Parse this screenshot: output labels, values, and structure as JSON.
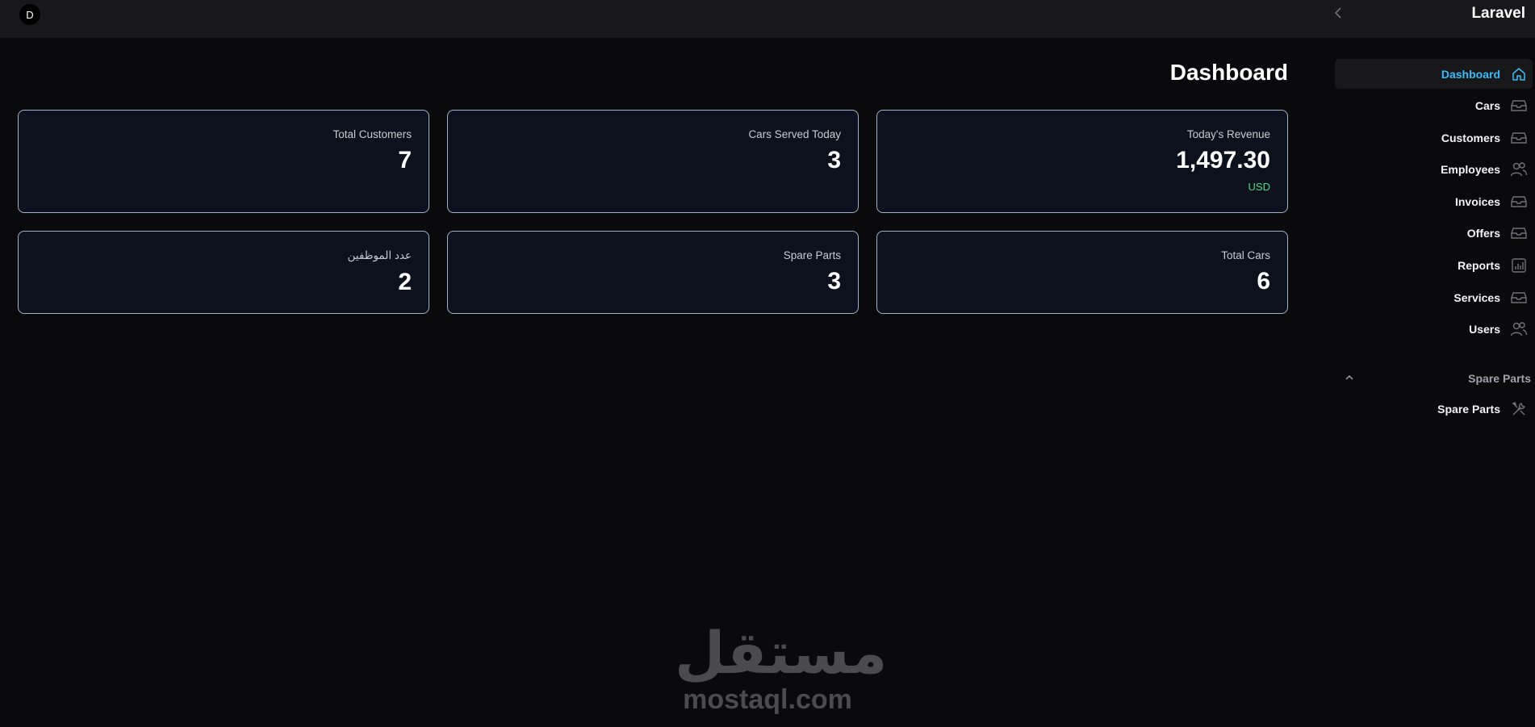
{
  "topbar": {
    "avatar_initial": "D",
    "collapse_icon": "chevron-left-icon",
    "brand": "Laravel"
  },
  "page": {
    "title": "Dashboard"
  },
  "cards": [
    {
      "label": "Total Customers",
      "value": "7"
    },
    {
      "label": "Cars Served Today",
      "value": "3"
    },
    {
      "label": "Today's Revenue",
      "value": "1,497.30",
      "unit": "USD"
    },
    {
      "label": "عدد الموظفين",
      "value": "2"
    },
    {
      "label": "Spare Parts",
      "value": "3"
    },
    {
      "label": "Total Cars",
      "value": "6"
    }
  ],
  "sidebar": {
    "items": [
      {
        "label": "Dashboard",
        "icon": "home-icon",
        "active": true
      },
      {
        "label": "Cars",
        "icon": "inbox-icon"
      },
      {
        "label": "Customers",
        "icon": "inbox-icon"
      },
      {
        "label": "Employees",
        "icon": "users-icon"
      },
      {
        "label": "Invoices",
        "icon": "inbox-icon"
      },
      {
        "label": "Offers",
        "icon": "inbox-icon"
      },
      {
        "label": "Reports",
        "icon": "bar-chart-icon"
      },
      {
        "label": "Services",
        "icon": "inbox-icon"
      },
      {
        "label": "Users",
        "icon": "users-icon"
      }
    ],
    "group": {
      "label": "Spare Parts",
      "toggle_icon": "chevron-up-icon",
      "items": [
        {
          "label": "Spare Parts",
          "icon": "wrench-screwdriver-icon"
        }
      ]
    }
  },
  "watermark": {
    "arabic": "مستقل",
    "latin": "mostaql.com"
  },
  "colors": {
    "background": "#0a0a0c",
    "topbar": "#18181b",
    "card_bg": "#0c111d",
    "card_border": "#9fb3c8",
    "active_accent": "#38bdf8",
    "currency_green": "#4ade80"
  }
}
